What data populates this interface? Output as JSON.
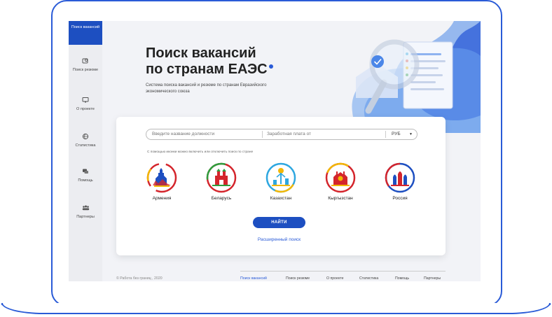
{
  "sidebar": {
    "active_item": "Поиск вакансий",
    "items": [
      {
        "label": "Поиск резюме",
        "icon": "resume-search-icon"
      },
      {
        "label": "О проекте",
        "icon": "monitor-icon"
      },
      {
        "label": "Статистика",
        "icon": "globe-icon"
      },
      {
        "label": "Помощь",
        "icon": "chat-icon"
      },
      {
        "label": "Партнеры",
        "icon": "partners-icon"
      }
    ]
  },
  "hero": {
    "title_line1": "Поиск вакансий",
    "title_line2": "по странам ЕАЭС",
    "subtitle": "Система поиска вакансий и резюме по странам Евразийского экономического союза"
  },
  "search": {
    "job_placeholder": "Введите название должности",
    "salary_placeholder": "Заработная плата от",
    "currency": "РУБ",
    "hint": "С помощью иконки можно включить или отключить поиск по стране",
    "find_button": "НАЙТИ",
    "advanced_link": "Расширенный поиск"
  },
  "countries": [
    {
      "name": "Армения",
      "icon": "armenia-emblem-icon",
      "colors": [
        "#d4252c",
        "#1d4fc1",
        "#f2b705"
      ]
    },
    {
      "name": "Беларусь",
      "icon": "belarus-emblem-icon",
      "colors": [
        "#d4252c",
        "#2e9e3e"
      ]
    },
    {
      "name": "Казахстан",
      "icon": "kazakhstan-emblem-icon",
      "colors": [
        "#2ea7e0",
        "#f2b705"
      ]
    },
    {
      "name": "Кыргызстан",
      "icon": "kyrgyzstan-emblem-icon",
      "colors": [
        "#d4252c",
        "#f2b705"
      ]
    },
    {
      "name": "Россия",
      "icon": "russia-emblem-icon",
      "colors": [
        "#1d4fc1",
        "#d4252c"
      ]
    }
  ],
  "footer": {
    "copyright": "© Работа без границ , 2020",
    "nav": [
      "Поиск вакансий",
      "Поиск резюме",
      "О проекте",
      "Статистика",
      "Помощь",
      "Партнеры"
    ]
  },
  "colors": {
    "accent": "#1d4fc1",
    "frame": "#2a5bd7",
    "background": "#f2f3f7"
  }
}
